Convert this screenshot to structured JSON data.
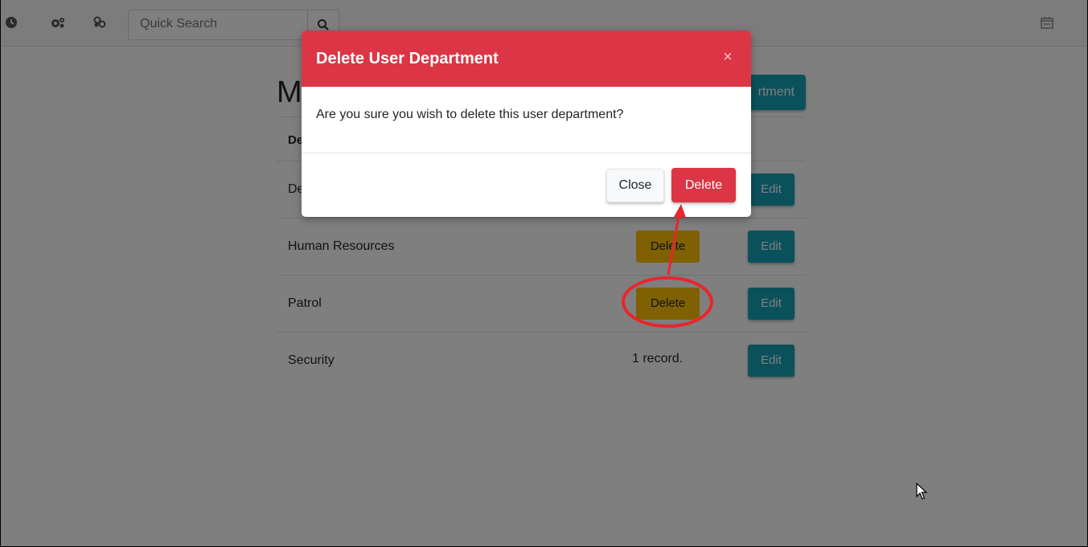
{
  "navbar": {
    "icons": [
      "clock-icon",
      "cogs-icon",
      "hands-icon",
      "calendar-icon"
    ],
    "search_placeholder": "Quick Search",
    "search_icon": "search-icon"
  },
  "page": {
    "title": "M",
    "add_button_label": "rtment",
    "column_header": "De",
    "rows": [
      {
        "name": "De",
        "delete_label": "",
        "edit_label": "Edit"
      },
      {
        "name": "Human Resources",
        "delete_label": "Delete",
        "edit_label": "Edit"
      },
      {
        "name": "Patrol",
        "delete_label": "Delete",
        "edit_label": "Edit"
      },
      {
        "name": "Security",
        "status": "1 record.",
        "edit_label": "Edit"
      }
    ]
  },
  "modal": {
    "title": "Delete User Department",
    "close_glyph": "×",
    "body": "Are you sure you wish to delete this user department?",
    "close_label": "Close",
    "delete_label": "Delete"
  },
  "colors": {
    "danger": "#dc3545",
    "info": "#17a2b8",
    "warning": "#ffc107",
    "annotation": "#e8262b"
  }
}
